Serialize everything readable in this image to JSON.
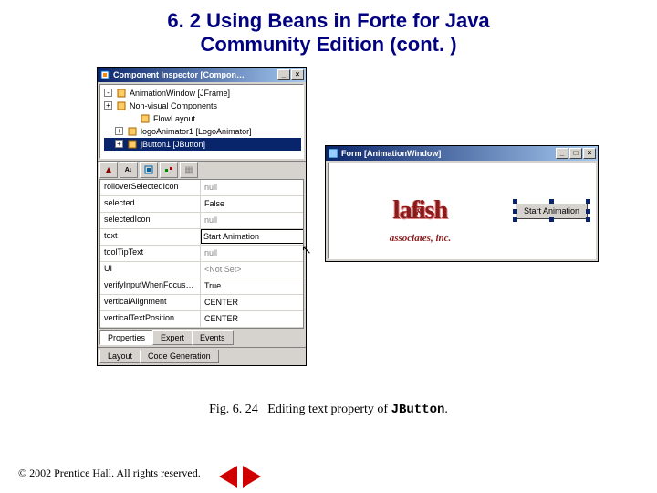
{
  "title_line1": "6. 2   Using Beans in Forte for Java",
  "title_line2": "Community Edition (cont. )",
  "inspector": {
    "title": "Component Inspector [Compon…",
    "tree": [
      {
        "label": "AnimationWindow [JFrame]",
        "expand": "-",
        "indent": 0,
        "sel": false
      },
      {
        "label": "Non-visual Components",
        "expand": "+",
        "indent": 0,
        "sel": false
      },
      {
        "label": "FlowLayout",
        "expand": "",
        "indent": 2,
        "sel": false
      },
      {
        "label": "logoAnimator1 [LogoAnimator]",
        "expand": "+",
        "indent": 1,
        "sel": false
      },
      {
        "label": "jButton1 [JButton]",
        "expand": "+",
        "indent": 1,
        "sel": true
      }
    ],
    "props": [
      {
        "name": "rolloverSelectedIcon",
        "value": "null",
        "null": true
      },
      {
        "name": "selected",
        "value": "False",
        "null": false
      },
      {
        "name": "selectedIcon",
        "value": "null",
        "null": true
      },
      {
        "name": "text",
        "value": "Start Animation",
        "editing": true
      },
      {
        "name": "toolTipText",
        "value": "null",
        "null": true
      },
      {
        "name": "UI",
        "value": "<Not Set>",
        "null": true
      },
      {
        "name": "verifyInputWhenFocus…",
        "value": "True",
        "null": false
      },
      {
        "name": "verticalAlignment",
        "value": "CENTER",
        "null": false
      },
      {
        "name": "verticalTextPosition",
        "value": "CENTER",
        "null": false
      }
    ],
    "tabs_top": [
      "Properties",
      "Expert",
      "Events"
    ],
    "tabs_bottom": [
      "Layout",
      "Code Generation"
    ]
  },
  "form": {
    "title": "Form [AnimationWindow]",
    "logo_main": "lafish",
    "logo_amp": "&",
    "logo_sub": "associates, inc.",
    "button_label": "Start Animation"
  },
  "caption_prefix": "Fig. 6. 24",
  "caption_text": "Editing text property of ",
  "caption_code": "JButton",
  "footer": "© 2002 Prentice Hall.  All rights reserved."
}
